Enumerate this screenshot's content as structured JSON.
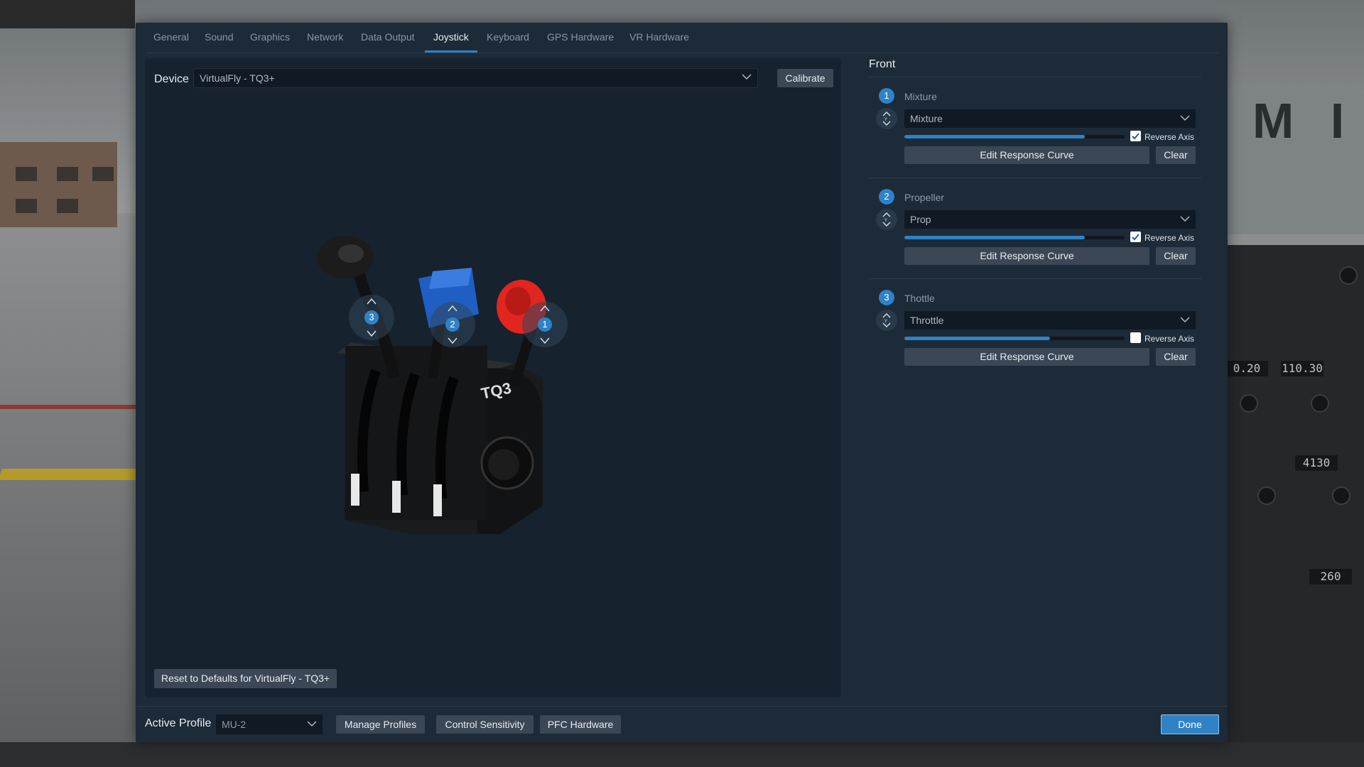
{
  "tabs": [
    {
      "label": "General"
    },
    {
      "label": "Sound"
    },
    {
      "label": "Graphics"
    },
    {
      "label": "Network"
    },
    {
      "label": "Data Output"
    },
    {
      "label": "Joystick",
      "active": true
    },
    {
      "label": "Keyboard"
    },
    {
      "label": "GPS Hardware"
    },
    {
      "label": "VR Hardware"
    }
  ],
  "device": {
    "label": "Device",
    "selected": "VirtualFly - TQ3+",
    "calibrate_label": "Calibrate",
    "reset_label": "Reset to Defaults for VirtualFly - TQ3+",
    "device_logo": "TQ3"
  },
  "device_markers": [
    {
      "number": "3"
    },
    {
      "number": "2"
    },
    {
      "number": "1"
    }
  ],
  "front": {
    "title": "Front",
    "axes": [
      {
        "number": "1",
        "name": "Mixture",
        "assignment": "Mixture",
        "level": 0.82,
        "reverse_label": "Reverse Axis",
        "reverse_checked": true,
        "edit_label": "Edit Response Curve",
        "clear_label": "Clear"
      },
      {
        "number": "2",
        "name": "Propeller",
        "assignment": "Prop",
        "level": 0.82,
        "reverse_label": "Reverse Axis",
        "reverse_checked": true,
        "edit_label": "Edit Response Curve",
        "clear_label": "Clear"
      },
      {
        "number": "3",
        "name": "Thottle",
        "assignment": "Throttle",
        "level": 0.66,
        "reverse_label": "Reverse Axis",
        "reverse_checked": false,
        "edit_label": "Edit Response Curve",
        "clear_label": "Clear"
      }
    ]
  },
  "footer": {
    "active_profile_label": "Active Profile",
    "profile_selected": "MU-2",
    "manage_profiles_label": "Manage Profiles",
    "control_sensitivity_label": "Control Sensitivity",
    "pfc_hardware_label": "PFC Hardware",
    "done_label": "Done"
  },
  "colors": {
    "accent": "#2f82c6",
    "dialog_bg": "#1d2a37",
    "panel_bg": "#16222e",
    "lever_blue": "#1f5fc4",
    "lever_red": "#e0261f"
  },
  "background": {
    "right_panel_readouts": [
      "0.20",
      "110.30",
      "4130",
      "260"
    ],
    "building_letters": "M I"
  }
}
